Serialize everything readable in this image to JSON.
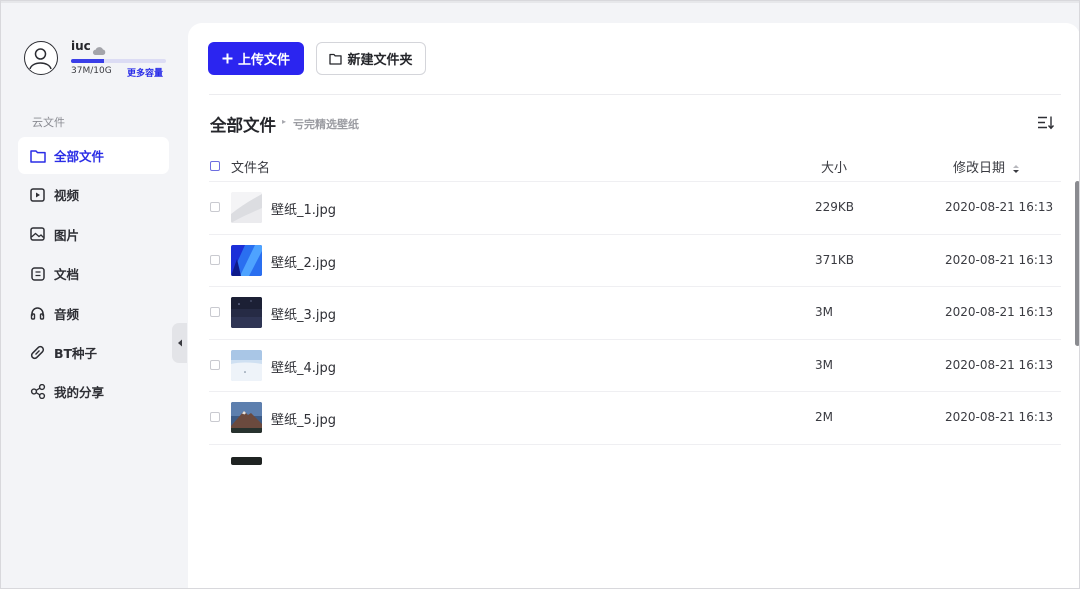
{
  "user": {
    "name": "iuc",
    "quota_text": "37M/10G",
    "quota_fraction": 0.35,
    "more_quota_label": "更多容量"
  },
  "sidebar": {
    "section_label": "云文件",
    "items": [
      {
        "label": "全部文件",
        "icon": "folder-icon",
        "active": true
      },
      {
        "label": "视频",
        "icon": "video-icon",
        "active": false
      },
      {
        "label": "图片",
        "icon": "image-icon",
        "active": false
      },
      {
        "label": "文档",
        "icon": "document-icon",
        "active": false
      },
      {
        "label": "音频",
        "icon": "headphones-icon",
        "active": false
      },
      {
        "label": "BT种子",
        "icon": "bt-seed-icon",
        "active": false
      },
      {
        "label": "我的分享",
        "icon": "share-icon",
        "active": false
      }
    ]
  },
  "toolbar": {
    "upload_label": "上传文件",
    "new_folder_label": "新建文件夹"
  },
  "breadcrumb": {
    "title": "全部文件",
    "separator": "▸",
    "sub": "亏完精选壁纸"
  },
  "table": {
    "columns": {
      "name": "文件名",
      "size": "大小",
      "date": "修改日期"
    },
    "rows": [
      {
        "name": "壁纸_1.jpg",
        "size": "229KB",
        "date": "2020-08-21 16:13",
        "thumb": "thumb-white"
      },
      {
        "name": "壁纸_2.jpg",
        "size": "371KB",
        "date": "2020-08-21 16:13",
        "thumb": "thumb-blue"
      },
      {
        "name": "壁纸_3.jpg",
        "size": "3M",
        "date": "2020-08-21 16:13",
        "thumb": "thumb-navy"
      },
      {
        "name": "壁纸_4.jpg",
        "size": "3M",
        "date": "2020-08-21 16:13",
        "thumb": "thumb-sky"
      },
      {
        "name": "壁纸_5.jpg",
        "size": "2M",
        "date": "2020-08-21 16:13",
        "thumb": "thumb-mountain"
      }
    ]
  },
  "colors": {
    "accent": "#2b25f0",
    "active_text": "#2a2de6",
    "sidebar_bg": "#f3f4f7",
    "panel_bg": "#ffffff"
  }
}
